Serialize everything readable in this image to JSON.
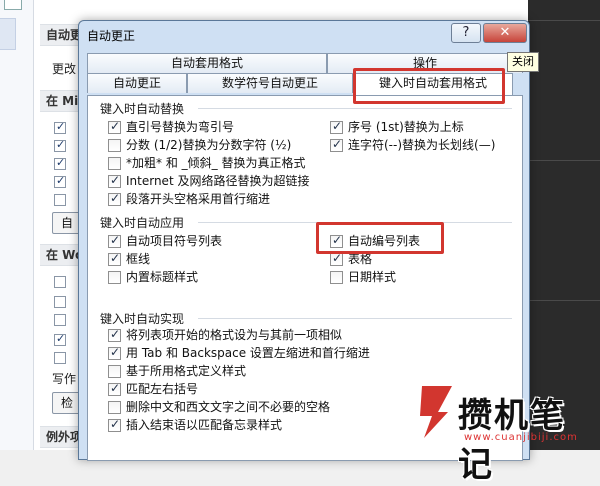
{
  "dialog": {
    "title": "自动更正",
    "help_glyph": "?",
    "close_glyph": "✕",
    "close_tooltip": "关闭"
  },
  "tabs_row1": [
    "自动套用格式",
    "操作"
  ],
  "tabs_row2": [
    "自动更正",
    "数学符号自动更正",
    "键入时自动套用格式"
  ],
  "groups": {
    "replace": {
      "title": "键入时自动替换",
      "items": [
        {
          "label": "直引号替换为弯引号",
          "checked": true
        },
        {
          "label": "分数 (1/2)替换为分数字符 (½)",
          "checked": false
        },
        {
          "label": "*加粗* 和 _倾斜_ 替换为真正格式",
          "checked": false
        },
        {
          "label": "Internet 及网络路径替换为超链接",
          "checked": true
        },
        {
          "label": "段落开头空格采用首行缩进",
          "checked": true
        },
        {
          "label": "序号 (1st)替换为上标",
          "checked": true
        },
        {
          "label": "连字符(--)替换为长划线(—)",
          "checked": true
        }
      ]
    },
    "apply": {
      "title": "键入时自动应用",
      "items": [
        {
          "label": "自动项目符号列表",
          "checked": true
        },
        {
          "label": "框线",
          "checked": true
        },
        {
          "label": "内置标题样式",
          "checked": false
        },
        {
          "label": "自动编号列表",
          "checked": true
        },
        {
          "label": "表格",
          "checked": true
        },
        {
          "label": "日期样式",
          "checked": false
        }
      ]
    },
    "auto": {
      "title": "键入时自动实现",
      "items": [
        {
          "label": "将列表项开始的格式设为与其前一项相似",
          "checked": true
        },
        {
          "label": "用 Tab 和 Backspace 设置左缩进和首行缩进",
          "checked": true
        },
        {
          "label": "基于所用格式定义样式",
          "checked": false
        },
        {
          "label": "匹配左右括号",
          "checked": true
        },
        {
          "label": "删除中文和西文文字之间不必要的空格",
          "checked": false
        },
        {
          "label": "插入结束语以匹配备忘录样式",
          "checked": true
        }
      ]
    }
  },
  "background": {
    "section1": "自动更",
    "line1": "更改",
    "section2": "在 Mi",
    "button1": "自",
    "section3": "在 Wo",
    "line_writing": "写作",
    "button2": "检",
    "section4": "例外项"
  },
  "watermark": {
    "text": "攒机笔记",
    "url": "www.cuanjibiji.com"
  },
  "colors": {
    "highlight": "#d2362f",
    "dialog_frame": "#cfe0f3",
    "close_button": "#c7443a"
  }
}
